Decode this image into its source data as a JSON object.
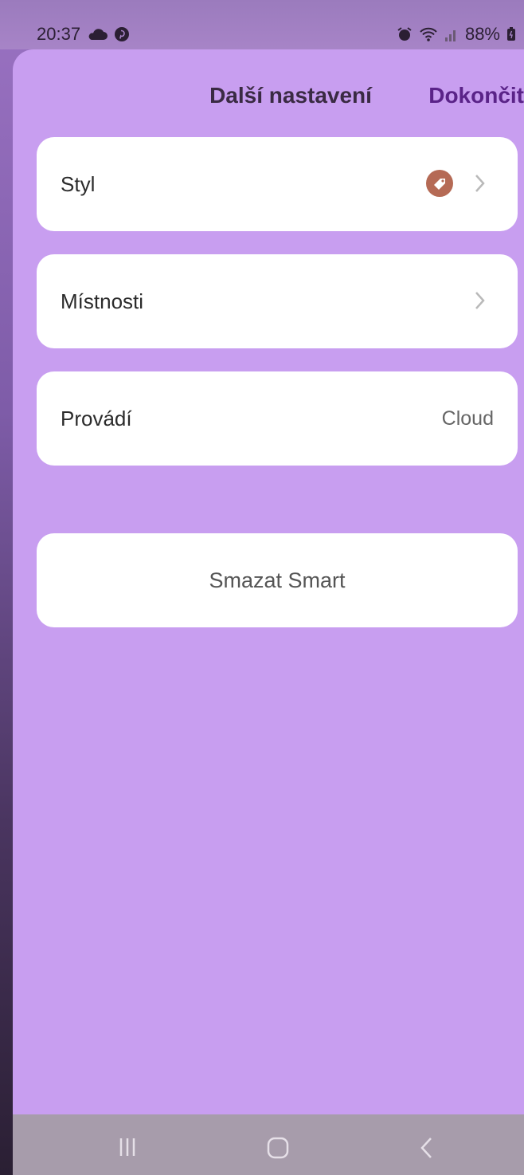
{
  "status_bar": {
    "time": "20:37",
    "battery": "88%",
    "left_icons": [
      "cloud-icon",
      "pinterest-icon"
    ],
    "right_icons": [
      "alarm-icon",
      "wifi-icon",
      "signal-icon",
      "battery-icon"
    ]
  },
  "header": {
    "title": "Další nastavení",
    "done_label": "Dokončit"
  },
  "settings": {
    "style": {
      "label": "Styl",
      "icon": "tag-icon",
      "icon_color": "#b56a55"
    },
    "rooms": {
      "label": "Místnosti"
    },
    "executes": {
      "label": "Provádí",
      "value": "Cloud"
    }
  },
  "delete_button": {
    "label": "Smazat Smart"
  },
  "colors": {
    "sheet_background": "#c89ef0",
    "accent": "#5a2388",
    "card_background": "#ffffff"
  },
  "nav_bar": {
    "icons": [
      "recent-apps-icon",
      "home-icon",
      "back-icon"
    ]
  }
}
